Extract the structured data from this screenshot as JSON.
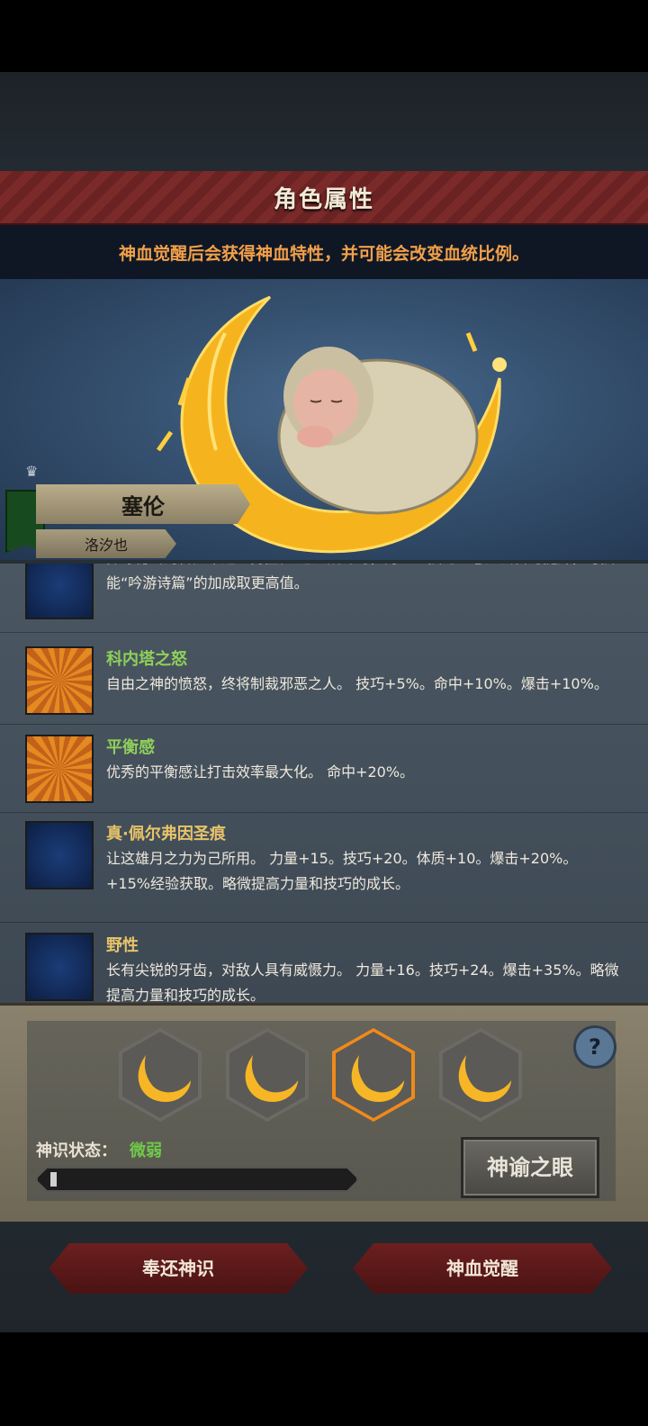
{
  "header": {
    "title": "角色属性"
  },
  "hint": "神血觉醒后会获得神血特性，并可能会改变血统比例。",
  "character": {
    "name": "塞伦",
    "subtitle": "洛汐也"
  },
  "traits": [
    {
      "name": "",
      "desc": "探寻秘密的冒险中越显勇猛。 进入战斗时，力量、技巧、感知会暂时提升，与技能“吟游诗篇”的加成取更高值。",
      "icon": "moon-icon"
    },
    {
      "name": "科内塔之怒",
      "desc": "自由之神的愤怒，终将制裁邪恶之人。 技巧+5%。命中+10%。爆击+10%。",
      "icon": "smiley-icon"
    },
    {
      "name": "平衡感",
      "desc": "优秀的平衡感让打击效率最大化。 命中+20%。",
      "icon": "smiley-icon"
    },
    {
      "name": "真·佩尔弗因圣痕",
      "desc": "让这雄月之力为己所用。 力量+15。技巧+20。体质+10。爆击+20%。+15%经验获取。略微提高力量和技巧的成长。",
      "icon": "moon-icon"
    },
    {
      "name": "野性",
      "desc": "长有尖锐的牙齿，对敌人具有威慑力。 力量+16。技巧+24。爆击+35%。略微提高力量和技巧的成长。",
      "icon": "moon-icon"
    }
  ],
  "slots": {
    "count": 4,
    "active_index": 2,
    "icon": "crescent-moon-icon"
  },
  "status": {
    "label": "神识状态：",
    "value": "微弱",
    "progress": 0.02
  },
  "buttons": {
    "oracle": "神谕之眼",
    "return": "奉还神识",
    "awaken": "神血觉醒",
    "help": "?"
  },
  "colors": {
    "accent_orange": "#f2a04a",
    "status_green": "#6fc94a",
    "trait_green": "#8fd05a",
    "trait_gold": "#e7c36a",
    "header_red": "#7b2a2a"
  }
}
